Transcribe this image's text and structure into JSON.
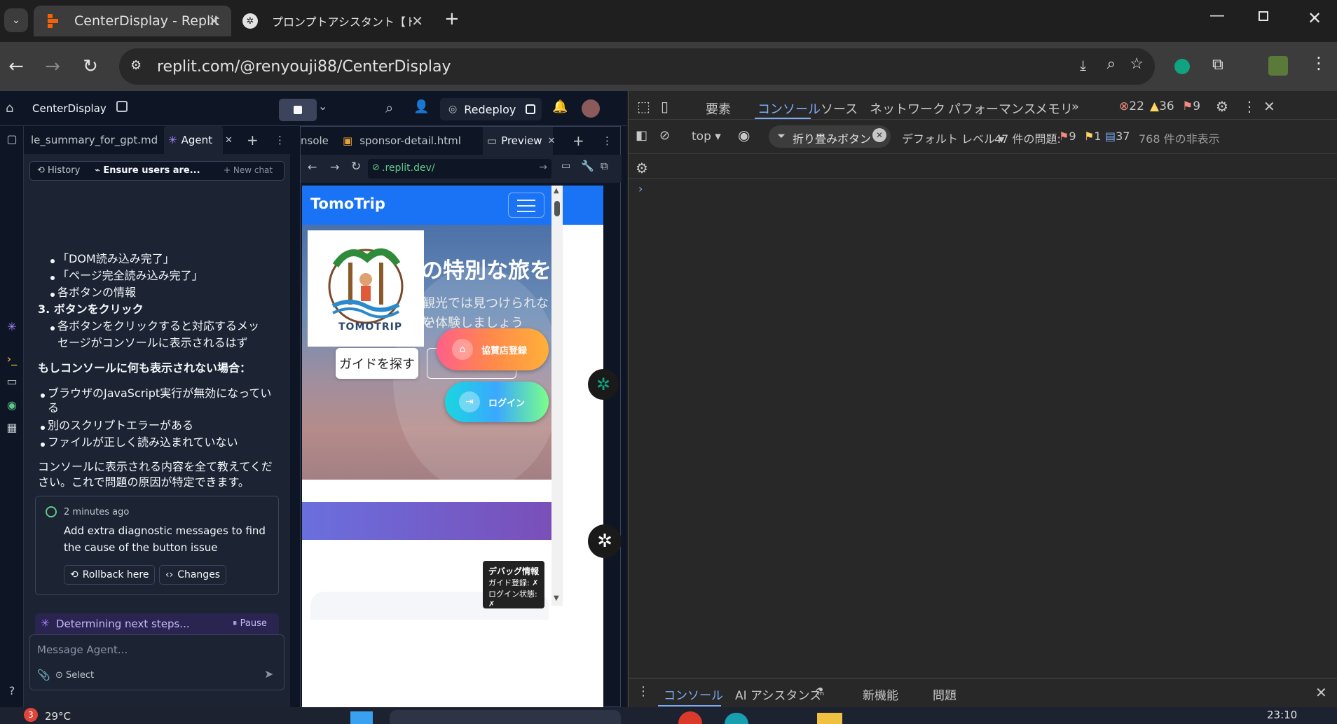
{
  "browser": {
    "tabs": [
      {
        "title": "CenterDisplay - Replit",
        "active": true,
        "icon": "replit-icon"
      },
      {
        "title": "プロンプトアシスタント【トゥモローブル",
        "active": false,
        "icon": "chatgpt-icon"
      }
    ],
    "url": "replit.com/@renyouji88/CenterDisplay"
  },
  "replit": {
    "project_name": "CenterDisplay",
    "redeploy_label": "Redeploy",
    "left_tabs": [
      "le_summary_for_gpt.md",
      "Agent"
    ],
    "agent_toolbar": {
      "history": "History",
      "current": "Ensure users are...",
      "new_chat": "+ New chat"
    },
    "agent_messages": {
      "b1": "「DOM読み込み完了」",
      "b2": "「ページ完全読み込み完了」",
      "b3": "各ボタンの情報",
      "step3": "3. ボタンをクリック",
      "step3_detail_1": "各ボタンをクリックすると対応するメッ",
      "step3_detail_2": "セージがコンソールに表示されるはず",
      "heading": "もしコンソールに何も表示されない場合：",
      "c1_1": "ブラウザのJavaScript実行が無効になってい",
      "c1_2": "る",
      "c2": "別のスクリプトエラーがある",
      "c3": "ファイルが正しく読み込まれていない",
      "outro_1": "コンソールに表示される内容を全て教えてくだ",
      "outro_2": "さい。これで問題の原因が特定できます。"
    },
    "checkpoint": {
      "time": "2 minutes ago",
      "message_1": "Add extra diagnostic messages to find",
      "message_2": "the cause of the button issue",
      "rollback": "Rollback here",
      "changes": "Changes"
    },
    "status": {
      "text": "Determining next steps...",
      "pause": "Pause"
    },
    "input": {
      "placeholder": "Message Agent...",
      "select": "Select"
    },
    "right_tabs": [
      "nsole",
      "sponsor-detail.html",
      "Preview"
    ],
    "preview_url": ".replit.dev/",
    "site": {
      "brand": "TomoTrip",
      "hero_title": "の特別な旅を",
      "hero_sub_1": "観光では見つけられない",
      "hero_sub_2": "を体験しましょう",
      "logo_text": "TOMOTRIP",
      "guide_button": "ガイドを探す",
      "sponsor_button": "協賛店登録",
      "login_button": "ログイン",
      "debug_title": "デバッグ情報",
      "debug_line1": "ガイド登録: ✗",
      "debug_line2": "ログイン状態: ✗"
    }
  },
  "devtools": {
    "tabs": [
      "要素",
      "コンソール",
      "ソース",
      "ネットワーク",
      "パフォーマンス",
      "メモリ"
    ],
    "counts": {
      "errors": "22",
      "warnings": "36",
      "issues": "9"
    },
    "context": "top",
    "filter": "折り畳みボタン",
    "level": "デフォルト レベル",
    "problems_label": "47 件の問題:",
    "problem_counts": {
      "errors": "9",
      "warnings": "1",
      "info": "37"
    },
    "hidden": "768 件の非表示",
    "bottom_tabs": [
      "コンソール",
      "AI アシスタンス",
      "新機能",
      "問題"
    ]
  },
  "taskbar": {
    "badge": "3",
    "temperature": "29°C",
    "time": "23:10"
  },
  "colors": {
    "replit_bg": "#0e1525",
    "devtools_bg": "#282828",
    "site_blue": "#1a73f5",
    "accent": "#7cacf8"
  }
}
